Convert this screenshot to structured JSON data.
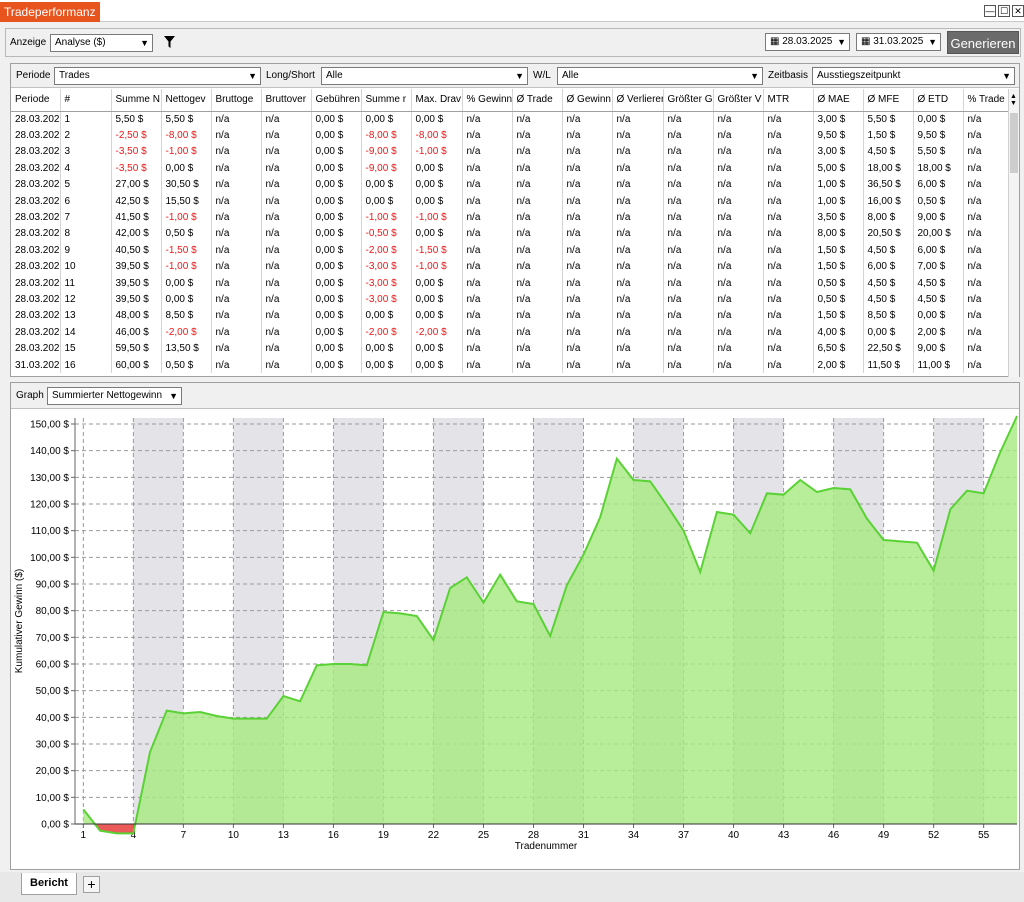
{
  "window": {
    "title": "Tradeperformanz",
    "min": "—",
    "max": "☐",
    "close": "✕"
  },
  "toolbar": {
    "display_label": "Anzeige",
    "display_value": "Analyse ($)",
    "filter_icon": "filter-icon",
    "date_from": "28.03.2025",
    "date_to": "31.03.2025",
    "generate_label": "Generieren"
  },
  "filters": {
    "period_label": "Periode",
    "period_value": "Trades",
    "longshort_label": "Long/Short",
    "longshort_value": "Alle",
    "wl_label": "W/L",
    "wl_value": "Alle",
    "timebase_label": "Zeitbasis",
    "timebase_value": "Ausstiegszeitpunkt"
  },
  "table": {
    "columns": [
      "Periode",
      "#",
      "Summe N",
      "Nettogev",
      "Bruttoge",
      "Bruttover",
      "Gebühren",
      "Summe r",
      "Max. Drav",
      "% Gewinn",
      "Ø Trade",
      "Ø Gewinn",
      "Ø Verlierer",
      "Größter G",
      "Größter V",
      "MTR",
      "Ø MAE",
      "Ø MFE",
      "Ø ETD",
      "% Trade"
    ],
    "rows": [
      [
        "28.03.202",
        "1",
        "5,50 $",
        "5,50 $",
        "n/a",
        "n/a",
        "0,00 $",
        "0,00 $",
        "0,00 $",
        "n/a",
        "n/a",
        "n/a",
        "n/a",
        "n/a",
        "n/a",
        "n/a",
        "3,00 $",
        "5,50 $",
        "0,00 $",
        "n/a"
      ],
      [
        "28.03.202",
        "2",
        "-2,50 $",
        "-8,00 $",
        "n/a",
        "n/a",
        "0,00 $",
        "-8,00 $",
        "-8,00 $",
        "n/a",
        "n/a",
        "n/a",
        "n/a",
        "n/a",
        "n/a",
        "n/a",
        "9,50 $",
        "1,50 $",
        "9,50 $",
        "n/a"
      ],
      [
        "28.03.202",
        "3",
        "-3,50 $",
        "-1,00 $",
        "n/a",
        "n/a",
        "0,00 $",
        "-9,00 $",
        "-1,00 $",
        "n/a",
        "n/a",
        "n/a",
        "n/a",
        "n/a",
        "n/a",
        "n/a",
        "3,00 $",
        "4,50 $",
        "5,50 $",
        "n/a"
      ],
      [
        "28.03.202",
        "4",
        "-3,50 $",
        "0,00 $",
        "n/a",
        "n/a",
        "0,00 $",
        "-9,00 $",
        "0,00 $",
        "n/a",
        "n/a",
        "n/a",
        "n/a",
        "n/a",
        "n/a",
        "n/a",
        "5,00 $",
        "18,00 $",
        "18,00 $",
        "n/a"
      ],
      [
        "28.03.202",
        "5",
        "27,00 $",
        "30,50 $",
        "n/a",
        "n/a",
        "0,00 $",
        "0,00 $",
        "0,00 $",
        "n/a",
        "n/a",
        "n/a",
        "n/a",
        "n/a",
        "n/a",
        "n/a",
        "1,00 $",
        "36,50 $",
        "6,00 $",
        "n/a"
      ],
      [
        "28.03.202",
        "6",
        "42,50 $",
        "15,50 $",
        "n/a",
        "n/a",
        "0,00 $",
        "0,00 $",
        "0,00 $",
        "n/a",
        "n/a",
        "n/a",
        "n/a",
        "n/a",
        "n/a",
        "n/a",
        "1,00 $",
        "16,00 $",
        "0,50 $",
        "n/a"
      ],
      [
        "28.03.202",
        "7",
        "41,50 $",
        "-1,00 $",
        "n/a",
        "n/a",
        "0,00 $",
        "-1,00 $",
        "-1,00 $",
        "n/a",
        "n/a",
        "n/a",
        "n/a",
        "n/a",
        "n/a",
        "n/a",
        "3,50 $",
        "8,00 $",
        "9,00 $",
        "n/a"
      ],
      [
        "28.03.202",
        "8",
        "42,00 $",
        "0,50 $",
        "n/a",
        "n/a",
        "0,00 $",
        "-0,50 $",
        "0,00 $",
        "n/a",
        "n/a",
        "n/a",
        "n/a",
        "n/a",
        "n/a",
        "n/a",
        "8,00 $",
        "20,50 $",
        "20,00 $",
        "n/a"
      ],
      [
        "28.03.202",
        "9",
        "40,50 $",
        "-1,50 $",
        "n/a",
        "n/a",
        "0,00 $",
        "-2,00 $",
        "-1,50 $",
        "n/a",
        "n/a",
        "n/a",
        "n/a",
        "n/a",
        "n/a",
        "n/a",
        "1,50 $",
        "4,50 $",
        "6,00 $",
        "n/a"
      ],
      [
        "28.03.202",
        "10",
        "39,50 $",
        "-1,00 $",
        "n/a",
        "n/a",
        "0,00 $",
        "-3,00 $",
        "-1,00 $",
        "n/a",
        "n/a",
        "n/a",
        "n/a",
        "n/a",
        "n/a",
        "n/a",
        "1,50 $",
        "6,00 $",
        "7,00 $",
        "n/a"
      ],
      [
        "28.03.202",
        "11",
        "39,50 $",
        "0,00 $",
        "n/a",
        "n/a",
        "0,00 $",
        "-3,00 $",
        "0,00 $",
        "n/a",
        "n/a",
        "n/a",
        "n/a",
        "n/a",
        "n/a",
        "n/a",
        "0,50 $",
        "4,50 $",
        "4,50 $",
        "n/a"
      ],
      [
        "28.03.202",
        "12",
        "39,50 $",
        "0,00 $",
        "n/a",
        "n/a",
        "0,00 $",
        "-3,00 $",
        "0,00 $",
        "n/a",
        "n/a",
        "n/a",
        "n/a",
        "n/a",
        "n/a",
        "n/a",
        "0,50 $",
        "4,50 $",
        "4,50 $",
        "n/a"
      ],
      [
        "28.03.202",
        "13",
        "48,00 $",
        "8,50 $",
        "n/a",
        "n/a",
        "0,00 $",
        "0,00 $",
        "0,00 $",
        "n/a",
        "n/a",
        "n/a",
        "n/a",
        "n/a",
        "n/a",
        "n/a",
        "1,50 $",
        "8,50 $",
        "0,00 $",
        "n/a"
      ],
      [
        "28.03.202",
        "14",
        "46,00 $",
        "-2,00 $",
        "n/a",
        "n/a",
        "0,00 $",
        "-2,00 $",
        "-2,00 $",
        "n/a",
        "n/a",
        "n/a",
        "n/a",
        "n/a",
        "n/a",
        "n/a",
        "4,00 $",
        "0,00 $",
        "2,00 $",
        "n/a"
      ],
      [
        "28.03.202",
        "15",
        "59,50 $",
        "13,50 $",
        "n/a",
        "n/a",
        "0,00 $",
        "0,00 $",
        "0,00 $",
        "n/a",
        "n/a",
        "n/a",
        "n/a",
        "n/a",
        "n/a",
        "n/a",
        "6,50 $",
        "22,50 $",
        "9,00 $",
        "n/a"
      ],
      [
        "31.03.202",
        "16",
        "60,00 $",
        "0,50 $",
        "n/a",
        "n/a",
        "0,00 $",
        "0,00 $",
        "0,00 $",
        "n/a",
        "n/a",
        "n/a",
        "n/a",
        "n/a",
        "n/a",
        "n/a",
        "2,00 $",
        "11,50 $",
        "11,00 $",
        "n/a"
      ]
    ]
  },
  "graph": {
    "label": "Graph",
    "value": "Summierter Nettogewinn"
  },
  "chart_data": {
    "type": "area",
    "xlabel": "Tradenummer",
    "ylabel": "Kumulativer Gewinn ($)",
    "ylim": [
      0,
      150
    ],
    "xlim": [
      1,
      57
    ],
    "grid": true,
    "yticks": [
      "0,00 $",
      "10,00 $",
      "20,00 $",
      "30,00 $",
      "40,00 $",
      "50,00 $",
      "60,00 $",
      "70,00 $",
      "80,00 $",
      "90,00 $",
      "100,00 $",
      "110,00 $",
      "120,00 $",
      "130,00 $",
      "140,00 $",
      "150,00 $"
    ],
    "xticks": [
      "1",
      "4",
      "7",
      "10",
      "13",
      "16",
      "19",
      "22",
      "25",
      "28",
      "31",
      "34",
      "37",
      "40",
      "43",
      "46",
      "49",
      "52",
      "55"
    ],
    "positive_color": "#a6ea80",
    "negative_color": "#e83c3c",
    "line_color": "#5ad235",
    "x": [
      1,
      2,
      3,
      4,
      5,
      6,
      7,
      8,
      9,
      10,
      11,
      12,
      13,
      14,
      15,
      16,
      17,
      18,
      19,
      20,
      21,
      22,
      23,
      24,
      25,
      26,
      27,
      28,
      29,
      30,
      31,
      32,
      33,
      34,
      35,
      36,
      37,
      38,
      39,
      40,
      41,
      42,
      43,
      44,
      45,
      46,
      47,
      48,
      49,
      50,
      51,
      52,
      53,
      54,
      55,
      56,
      57
    ],
    "values": [
      5.5,
      -2.5,
      -3.5,
      -3.5,
      27,
      42.5,
      41.5,
      42,
      40.5,
      39.5,
      39.5,
      39.5,
      48,
      46,
      59.5,
      60,
      60,
      59.5,
      79.5,
      79,
      78,
      69,
      88.5,
      92.5,
      83,
      93.5,
      83.5,
      82.5,
      70.5,
      89.5,
      101,
      115,
      137,
      129,
      128.5,
      119.5,
      110,
      94.5,
      117,
      116,
      109,
      124,
      123.5,
      129,
      124.5,
      126,
      125.5,
      114.5,
      106.5,
      106,
      105.5,
      95,
      118,
      125,
      124,
      139.5,
      153
    ]
  }
}
